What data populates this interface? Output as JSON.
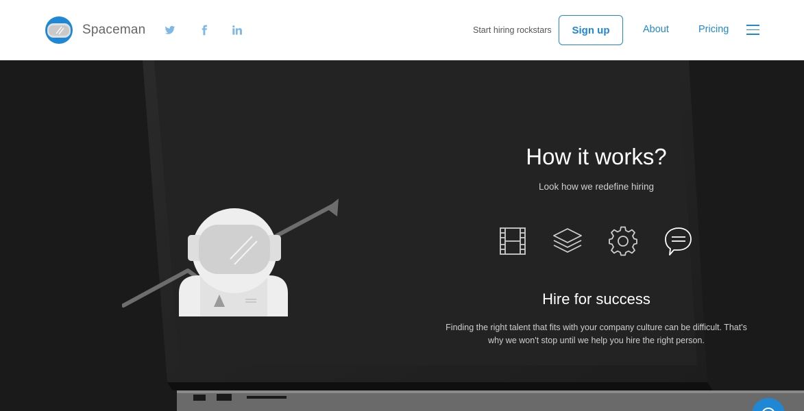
{
  "brand": {
    "name": "Spaceman"
  },
  "social": {
    "twitter": "twitter-icon",
    "facebook": "facebook-icon",
    "linkedin": "linkedin-icon"
  },
  "nav": {
    "tagline": "Start hiring rockstars",
    "signup": "Sign up",
    "about": "About",
    "pricing": "Pricing"
  },
  "hero": {
    "title": "How it works?",
    "subtitle": "Look how we redefine hiring",
    "features": [
      "film-icon",
      "layers-icon",
      "gear-icon",
      "chat-bubble-icon"
    ],
    "heading": "Hire for success",
    "description": "Finding the right talent that fits with your company culture can be difficult. That's why we won't stop until we help you hire the right person."
  },
  "colors": {
    "accent": "#1e88d6",
    "hero_bg": "#1b1b1b"
  }
}
